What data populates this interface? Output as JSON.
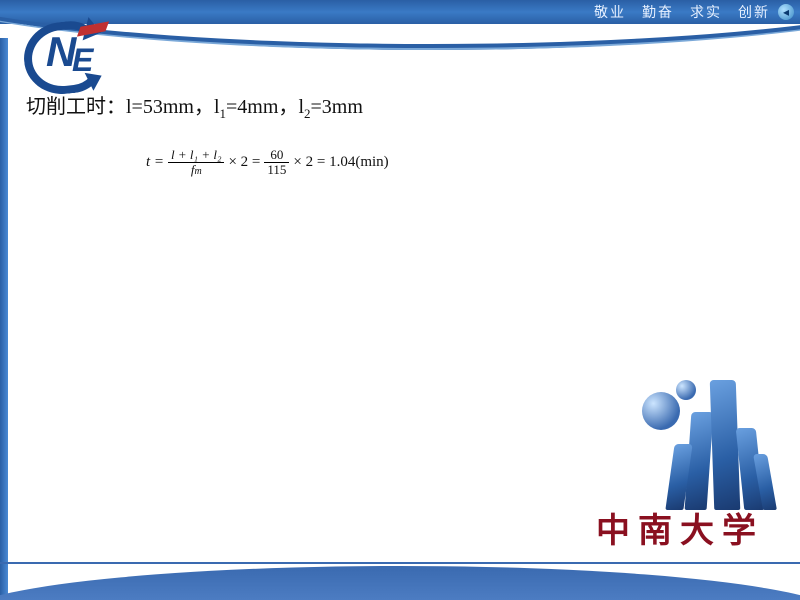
{
  "banner": {
    "motto": "敬业　勤奋　求实　创新"
  },
  "content": {
    "prefix": "切削工时：",
    "l_label": "l=",
    "l_val": "53mm，",
    "l1_label": "l",
    "l1_sub": "1",
    "l1_eq": "=4mm，",
    "l2_label": "l",
    "l2_sub": "2",
    "l2_eq": "=3mm"
  },
  "formula": {
    "t_eq": "t =",
    "num1": "l + l₁ + l₂",
    "den1_f": "f",
    "den1_m": "m",
    "times1": "× 2 =",
    "num2": "60",
    "den2": "115",
    "times2": "× 2 = 1.04(min)"
  },
  "footer": {
    "university": "中南大学"
  }
}
